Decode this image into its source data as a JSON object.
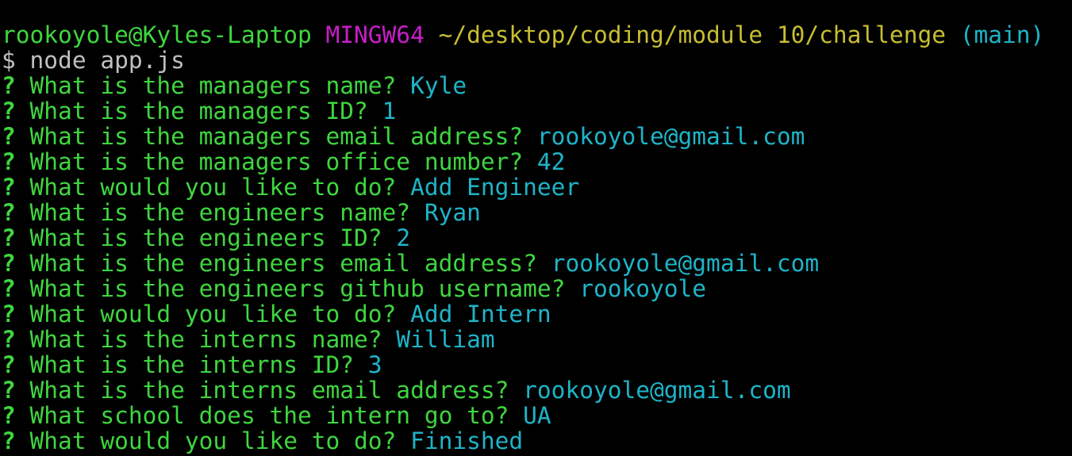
{
  "colors": {
    "background": "#000000",
    "prompt_user": "#3fd63f",
    "prompt_system": "#c81ec8",
    "prompt_path": "#c8be32",
    "prompt_branch": "#1eb4c8",
    "question": "#3fd63f",
    "answer": "#1eb4c8",
    "command": "#c0c0c0"
  },
  "prompt": {
    "user_host": "rookoyole@Kyles-Laptop",
    "system": "MINGW64",
    "path": "~/desktop/coding/module 10/challenge",
    "branch": "(main)"
  },
  "command": {
    "symbol": "$",
    "text": "node app.js"
  },
  "qa": [
    {
      "question": "What is the managers name?",
      "answer": "Kyle"
    },
    {
      "question": "What is the managers ID?",
      "answer": "1"
    },
    {
      "question": "What is the managers email address?",
      "answer": "rookoyole@gmail.com"
    },
    {
      "question": "What is the managers office number?",
      "answer": "42"
    },
    {
      "question": "What would you like to do?",
      "answer": "Add Engineer"
    },
    {
      "question": "What is the engineers name?",
      "answer": "Ryan"
    },
    {
      "question": "What is the engineers ID?",
      "answer": "2"
    },
    {
      "question": "What is the engineers email address?",
      "answer": "rookoyole@gmail.com"
    },
    {
      "question": "What is the engineers github username?",
      "answer": "rookoyole"
    },
    {
      "question": "What would you like to do?",
      "answer": "Add Intern"
    },
    {
      "question": "What is the interns name?",
      "answer": "William"
    },
    {
      "question": "What is the interns ID?",
      "answer": "3"
    },
    {
      "question": "What is the interns email address?",
      "answer": "rookoyole@gmail.com"
    },
    {
      "question": "What school does the intern go to?",
      "answer": "UA"
    },
    {
      "question": "What would you like to do?",
      "answer": "Finished"
    }
  ],
  "question_marker": "?"
}
